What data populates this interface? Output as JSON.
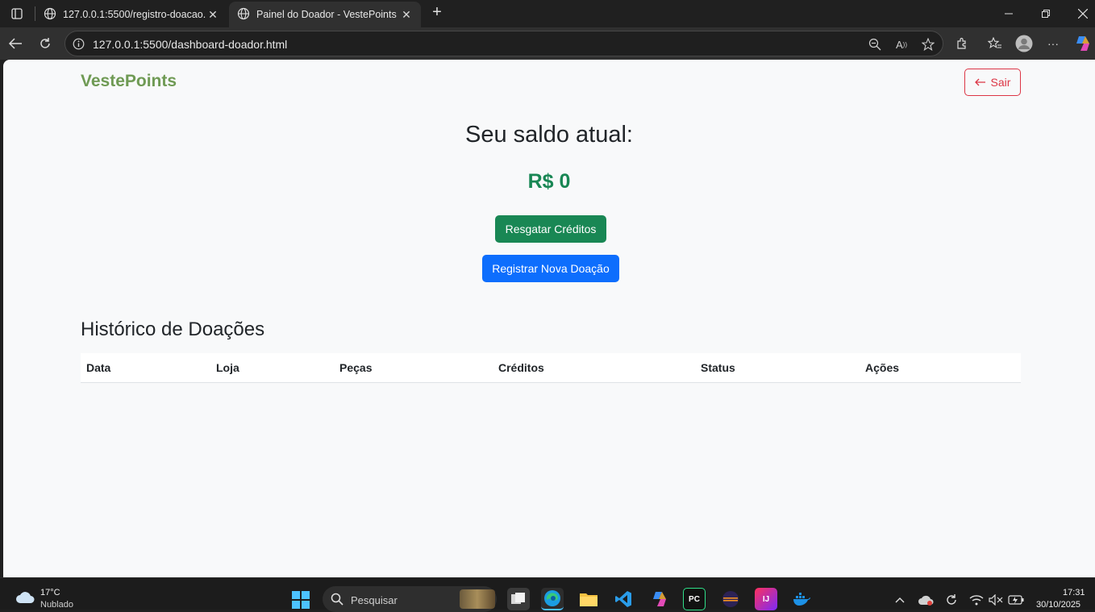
{
  "browser": {
    "tabs": [
      {
        "title": "127.0.0.1:5500/registro-doacao.html",
        "active": false
      },
      {
        "title": "Painel do Doador - VestePoints",
        "active": true
      }
    ],
    "url": "127.0.0.1:5500/dashboard-doador.html"
  },
  "page": {
    "brand": "VestePoints",
    "logout_label": "Sair",
    "balance_heading": "Seu saldo atual:",
    "balance_value": "R$ 0",
    "redeem_label": "Resgatar Créditos",
    "new_donation_label": "Registrar Nova Doação",
    "history_title": "Histórico de Doações",
    "table_headers": [
      "Data",
      "Loja",
      "Peças",
      "Créditos",
      "Status",
      "Ações"
    ],
    "colors": {
      "brand": "#6f9a54",
      "success": "#198754",
      "primary": "#0d6efd",
      "danger": "#dc3545"
    }
  },
  "taskbar": {
    "weather_temp": "17°C",
    "weather_desc": "Nublado",
    "search_placeholder": "Pesquisar",
    "time": "17:31",
    "date": "30/10/2025"
  }
}
